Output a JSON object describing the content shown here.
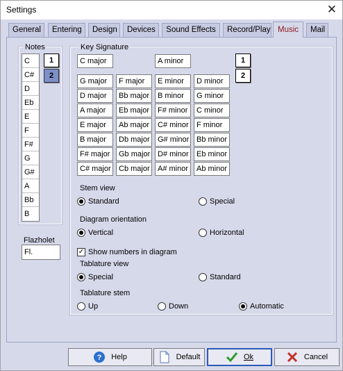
{
  "window": {
    "title": "Settings",
    "close_glyph": "✕"
  },
  "tabs": [
    {
      "label": "General"
    },
    {
      "label": "Entering"
    },
    {
      "label": "Design"
    },
    {
      "label": "Devices"
    },
    {
      "label": "Sound Effects"
    },
    {
      "label": "Record/Play"
    },
    {
      "label": "Music"
    },
    {
      "label": "Mail"
    }
  ],
  "active_tab": "Music",
  "notes": {
    "label": "Notes",
    "items": [
      "C",
      "C#",
      "D",
      "Eb",
      "E",
      "F",
      "F#",
      "G",
      "G#",
      "A",
      "Bb",
      "B"
    ],
    "buttons": [
      "1",
      "2"
    ],
    "selected_button": "2"
  },
  "key_signature": {
    "label": "Key Signature",
    "major_top": "C major",
    "minor_top": "A minor",
    "major_col1": [
      "G major",
      "D major",
      "A major",
      "E major",
      "B major",
      "F# major",
      "C# major"
    ],
    "major_col2": [
      "F major",
      "Bb major",
      "Eb major",
      "Ab major",
      "Db major",
      "Gb major",
      "Cb major"
    ],
    "minor_col1": [
      "E minor",
      "B minor",
      "F# minor",
      "C# minor",
      "G# minor",
      "D# minor",
      "A# minor"
    ],
    "minor_col2": [
      "D minor",
      "G minor",
      "C minor",
      "F minor",
      "Bb minor",
      "Eb minor",
      "Ab minor"
    ],
    "buttons": [
      "1",
      "2"
    ]
  },
  "stem_view": {
    "label": "Stem view",
    "options": [
      "Standard",
      "Special"
    ],
    "selected": "Standard"
  },
  "diagram_orientation": {
    "label": "Diagram orientation",
    "options": [
      "Vertical",
      "Horizontal"
    ],
    "selected": "Vertical"
  },
  "show_numbers": {
    "label": "Show numbers in diagram",
    "checked": true
  },
  "tablature_view": {
    "label": "Tablature view",
    "options": [
      "Special",
      "Standard"
    ],
    "selected": "Special"
  },
  "tablature_stem": {
    "label": "Tablature stem",
    "options": [
      "Up",
      "Down",
      "Automatic"
    ],
    "selected": "Automatic"
  },
  "flazholet": {
    "label": "Flazholet",
    "value": "Fl."
  },
  "footer": {
    "help_label": "Help",
    "default_label": "Default",
    "ok_label": "Ok",
    "cancel_label": "Cancel"
  },
  "icons": {
    "help": "help-icon",
    "default": "document-icon",
    "ok": "checkmark-icon",
    "cancel": "x-icon"
  },
  "colors": {
    "active_tab_text": "#8b1a1a",
    "selected_button": "#7d8fc8",
    "ok_check": "#2e9a2e",
    "cancel_x": "#c0302a",
    "help_blue": "#2c6fcf"
  }
}
